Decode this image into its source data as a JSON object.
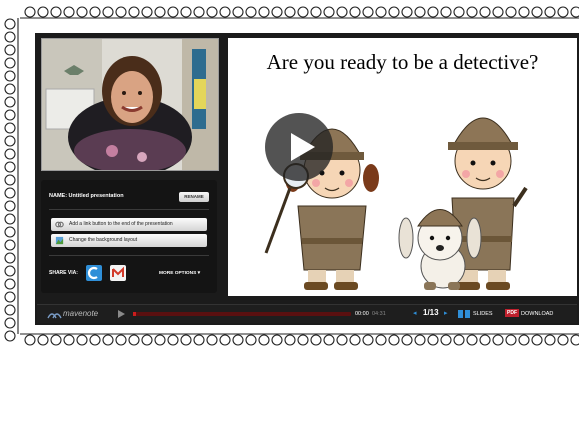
{
  "slide": {
    "title": "Are you ready to be a detective?"
  },
  "panel": {
    "name_label": "NAME: Untitled presentation",
    "rename_button": "RENAME",
    "option_add_link": "Add a link button to the end of the presentation",
    "option_change_bg": "Change the background layout",
    "share_via": "SHARE VIA:",
    "more_options": "MORE OPTIONS ▾"
  },
  "player": {
    "brand": "mavenote",
    "current_time": "00:00",
    "total_time": "04:31",
    "slide_counter": "1/13",
    "slides_label": "SLIDES",
    "pdf_badge": "PDF",
    "download_label": "DOWNLOAD"
  },
  "colors": {
    "progress_red": "#cc1d1d",
    "accent_blue": "#2f8fd8",
    "trench_coat": "#8a7558",
    "hat": "#8d7556"
  },
  "icons": {
    "play": "play-icon",
    "share_1": "share-blue-icon",
    "share_2": "gmail-icon"
  }
}
